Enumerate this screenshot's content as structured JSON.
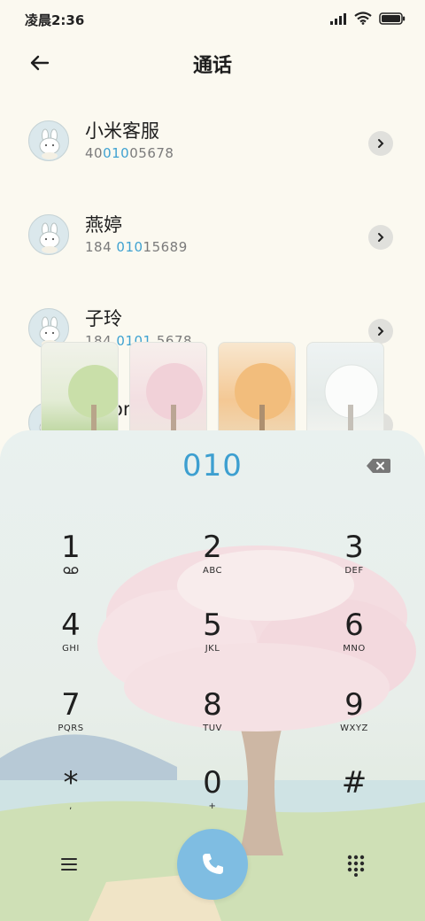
{
  "status": {
    "time": "凌晨2:36",
    "icons": [
      "signal-icon",
      "wifi-icon",
      "battery-icon"
    ]
  },
  "header": {
    "title": "通话",
    "back_icon": "arrow-left-icon"
  },
  "contacts": [
    {
      "name": "小米客服",
      "number_pre": "40",
      "number_match": "010",
      "number_post": "05678"
    },
    {
      "name": "燕婷",
      "number_pre": "184 ",
      "number_match": "010",
      "number_post": "15689"
    },
    {
      "name": "子玲",
      "number_pre": "184 ",
      "number_match": "0101",
      "number_post": " 5678"
    },
    {
      "name": "Jason",
      "number_pre": "",
      "number_match": "",
      "number_post": ""
    }
  ],
  "dialer": {
    "input": "010",
    "keys": [
      {
        "digit": "1",
        "letters": ""
      },
      {
        "digit": "2",
        "letters": "ABC"
      },
      {
        "digit": "3",
        "letters": "DEF"
      },
      {
        "digit": "4",
        "letters": "GHI"
      },
      {
        "digit": "5",
        "letters": "JKL"
      },
      {
        "digit": "6",
        "letters": "MNO"
      },
      {
        "digit": "7",
        "letters": "PQRS"
      },
      {
        "digit": "8",
        "letters": "TUV"
      },
      {
        "digit": "9",
        "letters": "WXYZ"
      },
      {
        "digit": "*",
        "letters": ","
      },
      {
        "digit": "0",
        "letters": "+"
      },
      {
        "digit": "#",
        "letters": ""
      }
    ]
  },
  "colors": {
    "accent": "#3fa2d1",
    "call_button": "#7fbde2",
    "background": "#fbf9f0"
  }
}
